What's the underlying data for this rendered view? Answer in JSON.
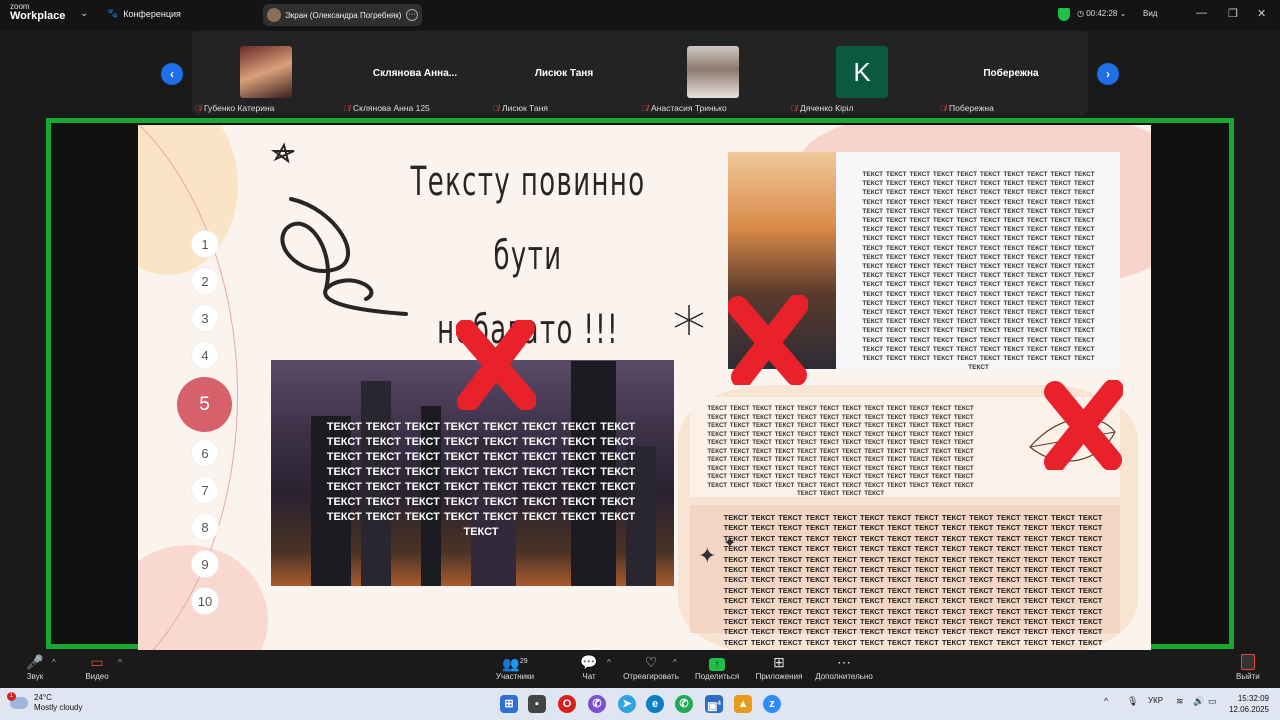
{
  "titlebar": {
    "logo_line1": "zoom",
    "logo_line2": "Workplace",
    "conference_label": "Конференция",
    "screen_share_label": "Экран (Олександра Погребняк)",
    "timer": "00:42:28",
    "view_label": "Вид",
    "shield_color": "#1fbf4a"
  },
  "participants": [
    {
      "display": "photo",
      "footer": "Губенко Катерина",
      "muted": true
    },
    {
      "display": "name",
      "big_name": "Склянова  Анна...",
      "footer": "Склянова Анна 125",
      "muted": true
    },
    {
      "display": "name",
      "big_name": "Лисюк Таня",
      "footer": "Лисюк Таня",
      "muted": true
    },
    {
      "display": "photo",
      "footer": "Анастасия Тринько",
      "muted": true
    },
    {
      "display": "letter",
      "letter": "K",
      "footer": "Дяченко Кіріл",
      "muted": true
    },
    {
      "display": "name",
      "big_name": "Побережна",
      "footer": "Побережна",
      "muted": true
    }
  ],
  "slide": {
    "title_line1": "Тексту повинно бути",
    "title_line2": "небагато !!!",
    "numbers": [
      "1",
      "2",
      "3",
      "4",
      "5",
      "6",
      "7",
      "8",
      "9",
      "10"
    ],
    "active_number": "5",
    "city_text": "ТЕКСТ ТЕКСТ ТЕКСТ ТЕКСТ ТЕКСТ ТЕКСТ ТЕКСТ ТЕКСТ ТЕКСТ ТЕКСТ ТЕКСТ ТЕКСТ ТЕКСТ ТЕКСТ ТЕКСТ ТЕКСТ ТЕКСТ ТЕКСТ ТЕКСТ ТЕКСТ ТЕКСТ ТЕКСТ ТЕКСТ ТЕКСТ ТЕКСТ ТЕКСТ ТЕКСТ ТЕКСТ ТЕКСТ ТЕКСТ ТЕКСТ ТЕКСТ ТЕКСТ ТЕКСТ ТЕКСТ ТЕКСТ ТЕКСТ ТЕКСТ ТЕКСТ ТЕКСТ ТЕКСТ ТЕКСТ ТЕКСТ ТЕКСТ ТЕКСТ ТЕКСТ ТЕКСТ ТЕКСТ ТЕКСТ ТЕКСТ ТЕКСТ ТЕКСТ ТЕКСТ ТЕКСТ ТЕКСТ ТЕКСТ ТЕКСТ",
    "book_text": "ТЕКСТ ТЕКСТ ТЕКСТ ТЕКСТ ТЕКСТ ТЕКСТ ТЕКСТ ТЕКСТ ТЕКСТ ТЕКСТ ТЕКСТ ТЕКСТ ТЕКСТ ТЕКСТ ТЕКСТ ТЕКСТ ТЕКСТ ТЕКСТ ТЕКСТ ТЕКСТ ТЕКСТ ТЕКСТ ТЕКСТ ТЕКСТ ТЕКСТ ТЕКСТ ТЕКСТ ТЕКСТ ТЕКСТ ТЕКСТ ТЕКСТ ТЕКСТ ТЕКСТ ТЕКСТ ТЕКСТ ТЕКСТ ТЕКСТ ТЕКСТ ТЕКСТ ТЕКСТ ТЕКСТ ТЕКСТ ТЕКСТ ТЕКСТ ТЕКСТ ТЕКСТ ТЕКСТ ТЕКСТ ТЕКСТ ТЕКСТ ТЕКСТ ТЕКСТ ТЕКСТ ТЕКСТ ТЕКСТ ТЕКСТ ТЕКСТ ТЕКСТ ТЕКСТ ТЕКСТ ТЕКСТ ТЕКСТ ТЕКСТ ТЕКСТ ТЕКСТ ТЕКСТ ТЕКСТ ТЕКСТ ТЕКСТ ТЕКСТ ТЕКСТ ТЕКСТ ТЕКСТ ТЕКСТ ТЕКСТ ТЕКСТ ТЕКСТ ТЕКСТ ТЕКСТ ТЕКСТ ТЕКСТ ТЕКСТ ТЕКСТ ТЕКСТ ТЕКСТ ТЕКСТ ТЕКСТ ТЕКСТ ТЕКСТ ТЕКСТ ТЕКСТ ТЕКСТ ТЕКСТ ТЕКСТ ТЕКСТ ТЕКСТ ТЕКСТ ТЕКСТ ТЕКСТ ТЕКСТ ТЕКСТ ТЕКСТ ТЕКСТ ТЕКСТ ТЕКСТ ТЕКСТ ТЕКСТ ТЕКСТ ТЕКСТ ТЕКСТ ТЕКСТ ТЕКСТ ТЕКСТ ТЕКСТ ТЕКСТ ТЕКСТ ТЕКСТ ТЕКСТ ТЕКСТ ТЕКСТ ТЕКСТ ТЕКСТ ТЕКСТ ТЕКСТ ТЕКСТ ТЕКСТ ТЕКСТ ТЕКСТ ТЕКСТ ТЕКСТ ТЕКСТ ТЕКСТ ТЕКСТ ТЕКСТ ТЕКСТ ТЕКСТ ТЕКСТ ТЕКСТ ТЕКСТ ТЕКСТ ТЕКСТ ТЕКСТ ТЕКСТ ТЕКСТ ТЕКСТ ТЕКСТ ТЕКСТ ТЕКСТ ТЕКСТ ТЕКСТ ТЕКСТ ТЕКСТ ТЕКСТ ТЕКСТ ТЕКСТ ТЕКСТ ТЕКСТ ТЕКСТ ТЕКСТ ТЕКСТ ТЕКСТ ТЕКСТ ТЕКСТ ТЕКСТ ТЕКСТ ТЕКСТ ТЕКСТ ТЕКСТ ТЕКСТ ТЕКСТ ТЕКСТ ТЕКСТ ТЕКСТ ТЕКСТ ТЕКСТ ТЕКСТ ТЕКСТ ТЕКСТ ТЕКСТ ТЕКСТ ТЕКСТ ТЕКСТ ТЕКСТ ТЕКСТ ТЕКСТ ТЕКСТ ТЕКСТ ТЕКСТ ТЕКСТ ТЕКСТ ТЕКСТ ТЕКСТ ТЕКСТ ТЕКСТ ТЕКСТ ТЕКСТ ТЕКСТ ТЕКСТ ТЕКСТ ТЕКСТ ТЕКСТ ТЕКСТ ТЕКСТ ТЕКСТ ТЕКСТ ТЕКСТ ТЕКСТ ТЕКСТ ТЕКСТ ТЕКСТ ТЕКСТ",
    "leaf_text": "ТЕКСТ ТЕКСТ ТЕКСТ ТЕКСТ ТЕКСТ ТЕКСТ ТЕКСТ ТЕКСТ ТЕКСТ ТЕКСТ ТЕКСТ ТЕКСТ ТЕКСТ ТЕКСТ ТЕКСТ ТЕКСТ ТЕКСТ ТЕКСТ ТЕКСТ ТЕКСТ ТЕКСТ ТЕКСТ ТЕКСТ ТЕКСТ ТЕКСТ ТЕКСТ ТЕКСТ ТЕКСТ ТЕКСТ ТЕКСТ ТЕКСТ ТЕКСТ ТЕКСТ ТЕКСТ ТЕКСТ ТЕКСТ ТЕКСТ ТЕКСТ ТЕКСТ ТЕКСТ ТЕКСТ ТЕКСТ ТЕКСТ ТЕКСТ ТЕКСТ ТЕКСТ ТЕКСТ ТЕКСТ ТЕКСТ ТЕКСТ ТЕКСТ ТЕКСТ ТЕКСТ ТЕКСТ ТЕКСТ ТЕКСТ ТЕКСТ ТЕКСТ ТЕКСТ ТЕКСТ ТЕКСТ ТЕКСТ ТЕКСТ ТЕКСТ ТЕКСТ ТЕКСТ ТЕКСТ ТЕКСТ ТЕКСТ ТЕКСТ ТЕКСТ ТЕКСТ ТЕКСТ ТЕКСТ ТЕКСТ ТЕКСТ ТЕКСТ ТЕКСТ ТЕКСТ ТЕКСТ ТЕКСТ ТЕКСТ ТЕКСТ ТЕКСТ ТЕКСТ ТЕКСТ ТЕКСТ ТЕКСТ ТЕКСТ ТЕКСТ ТЕКСТ ТЕКСТ ТЕКСТ ТЕКСТ ТЕКСТ ТЕКСТ ТЕКСТ ТЕКСТ ТЕКСТ ТЕКСТ ТЕКСТ ТЕКСТ ТЕКСТ ТЕКСТ ТЕКСТ ТЕКСТ ТЕКСТ ТЕКСТ ТЕКСТ ТЕКСТ ТЕКСТ ТЕКСТ ТЕКСТ ТЕКСТ ТЕКСТ ТЕКСТ ТЕКСТ ТЕКСТ ТЕКСТ ТЕКСТ ТЕКСТ ТЕКСТ ТЕКСТ ТЕКСТ",
    "low_text": "ТЕКСТ ТЕКСТ ТЕКСТ ТЕКСТ ТЕКСТ ТЕКСТ ТЕКСТ ТЕКСТ ТЕКСТ ТЕКСТ ТЕКСТ ТЕКСТ ТЕКСТ ТЕКСТ ТЕКСТ ТЕКСТ ТЕКСТ ТЕКСТ ТЕКСТ ТЕКСТ ТЕКСТ ТЕКСТ ТЕКСТ ТЕКСТ ТЕКСТ ТЕКСТ ТЕКСТ ТЕКСТ ТЕКСТ ТЕКСТ ТЕКСТ ТЕКСТ ТЕКСТ ТЕКСТ ТЕКСТ ТЕКСТ ТЕКСТ ТЕКСТ ТЕКСТ ТЕКСТ ТЕКСТ ТЕКСТ ТЕКСТ ТЕКСТ ТЕКСТ ТЕКСТ ТЕКСТ ТЕКСТ ТЕКСТ ТЕКСТ ТЕКСТ ТЕКСТ ТЕКСТ ТЕКСТ ТЕКСТ ТЕКСТ ТЕКСТ ТЕКСТ ТЕКСТ ТЕКСТ ТЕКСТ ТЕКСТ ТЕКСТ ТЕКСТ ТЕКСТ ТЕКСТ ТЕКСТ ТЕКСТ ТЕКСТ ТЕКСТ ТЕКСТ ТЕКСТ ТЕКСТ ТЕКСТ ТЕКСТ ТЕКСТ ТЕКСТ ТЕКСТ ТЕКСТ ТЕКСТ ТЕКСТ ТЕКСТ ТЕКСТ ТЕКСТ ТЕКСТ ТЕКСТ ТЕКСТ ТЕКСТ ТЕКСТ ТЕКСТ ТЕКСТ ТЕКСТ ТЕКСТ ТЕКСТ ТЕКСТ ТЕКСТ ТЕКСТ ТЕКСТ ТЕКСТ ТЕКСТ ТЕКСТ ТЕКСТ ТЕКСТ ТЕКСТ ТЕКСТ ТЕКСТ ТЕКСТ ТЕКСТ ТЕКСТ ТЕКСТ ТЕКСТ ТЕКСТ ТЕКСТ ТЕКСТ ТЕКСТ ТЕКСТ ТЕКСТ ТЕКСТ ТЕКСТ ТЕКСТ ТЕКСТ ТЕКСТ ТЕКСТ ТЕКСТ ТЕКСТ ТЕКСТ ТЕКСТ ТЕКСТ ТЕКСТ ТЕКСТ ТЕКСТ ТЕКСТ ТЕКСТ ТЕКСТ ТЕКСТ ТЕКСТ ТЕКСТ ТЕКСТ ТЕКСТ ТЕКСТ ТЕКСТ ТЕКСТ ТЕКСТ ТЕКСТ ТЕКСТ ТЕКСТ ТЕКСТ ТЕКСТ ТЕКСТ ТЕКСТ ТЕКСТ ТЕКСТ ТЕКСТ ТЕКСТ ТЕКСТ ТЕКСТ ТЕКСТ ТЕКСТ ТЕКСТ ТЕКСТ ТЕКСТ ТЕКСТ ТЕКСТ ТЕКСТ ТЕКСТ ТЕКСТ ТЕКСТ ТЕКСТ ТЕКСТ ТЕКСТ ТЕКСТ ТЕКСТ ТЕКСТ ТЕКСТ ТЕКСТ ТЕКСТ ТЕКСТ ТЕКСТ ТЕКСТ ТЕКСТ ТЕКСТ ТЕКСТ ТЕКСТ ТЕКСТ",
    "accent_color": "#d6616b",
    "cross_color": "#e8212b"
  },
  "toolbar": {
    "audio_label": "Звук",
    "video_label": "Видео",
    "participants_count": "29",
    "participants_label": "Участники",
    "chat_label": "Чат",
    "react_label": "Отреагировать",
    "share_label": "Поделиться",
    "apps_label": "Приложения",
    "more_label": "Дополнительно",
    "leave_label": "Выйти",
    "share_color": "#1fbf4a"
  },
  "taskbar": {
    "weather_badge": "1",
    "temperature": "24°C",
    "condition": "Mostly cloudy",
    "store_badge": "4",
    "language": "УКР",
    "time": "15:32:09",
    "date": "12.06.2025"
  }
}
